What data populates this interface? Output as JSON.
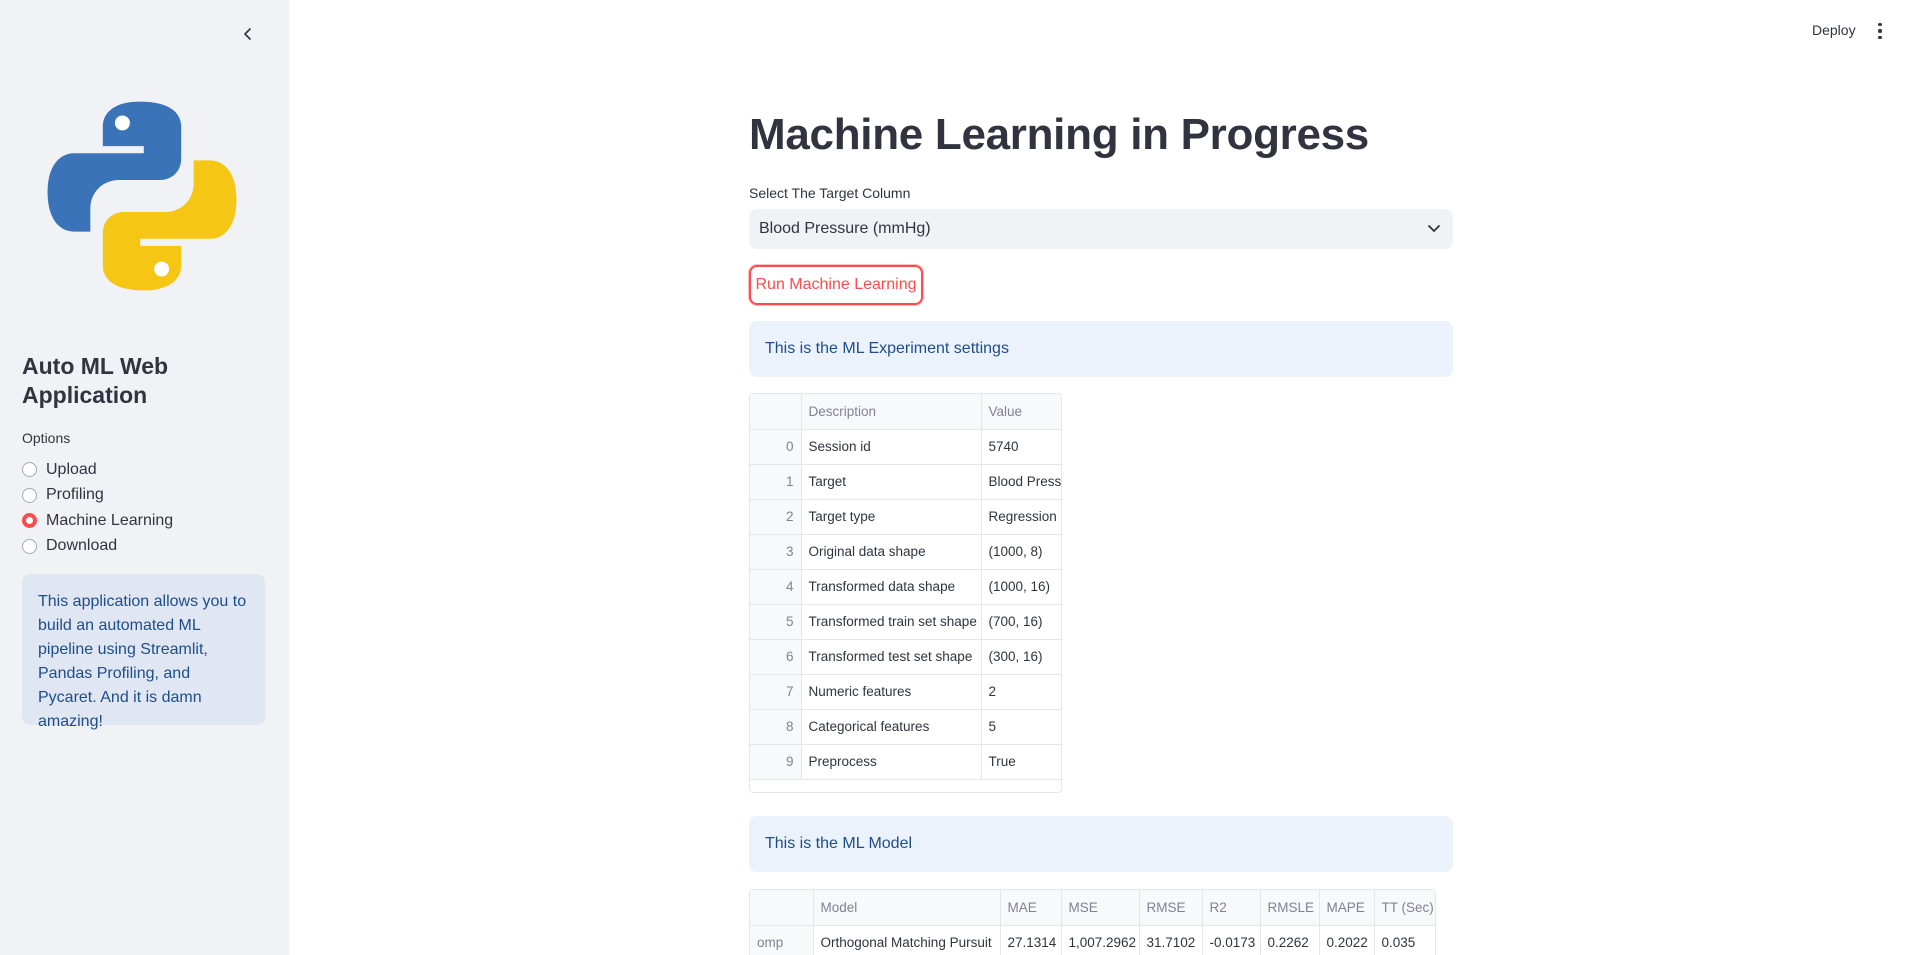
{
  "header": {
    "deploy_label": "Deploy"
  },
  "sidebar": {
    "app_title": "Auto ML Web Application",
    "options_label": "Options",
    "options": [
      {
        "label": "Upload",
        "selected": false
      },
      {
        "label": "Profiling",
        "selected": false
      },
      {
        "label": "Machine Learning",
        "selected": true
      },
      {
        "label": "Download",
        "selected": false
      }
    ],
    "info_text": "This application allows you to build an automated ML pipeline using Streamlit, Pandas Profiling, and Pycaret. And it is damn amazing!"
  },
  "main": {
    "title": "Machine Learning in Progress",
    "select_label": "Select The Target Column",
    "select_value": "Blood Pressure (mmHg)",
    "run_button": "Run Machine Learning",
    "settings_alert": "This is the ML Experiment settings",
    "settings_table": {
      "columns": [
        "",
        "Description",
        "Value"
      ],
      "rows": [
        [
          "0",
          "Session id",
          "5740"
        ],
        [
          "1",
          "Target",
          "Blood Pressure (mmHg)"
        ],
        [
          "2",
          "Target type",
          "Regression"
        ],
        [
          "3",
          "Original data shape",
          "(1000, 8)"
        ],
        [
          "4",
          "Transformed data shape",
          "(1000, 16)"
        ],
        [
          "5",
          "Transformed train set shape",
          "(700, 16)"
        ],
        [
          "6",
          "Transformed test set shape",
          "(300, 16)"
        ],
        [
          "7",
          "Numeric features",
          "2"
        ],
        [
          "8",
          "Categorical features",
          "5"
        ],
        [
          "9",
          "Preprocess",
          "True"
        ]
      ]
    },
    "model_alert": "This is the ML Model",
    "model_table": {
      "columns": [
        "",
        "Model",
        "MAE",
        "MSE",
        "RMSE",
        "R2",
        "RMSLE",
        "MAPE",
        "TT (Sec)"
      ],
      "rows": [
        [
          "omp",
          "Orthogonal Matching Pursuit",
          "27.1314",
          "1,007.2962",
          "31.7102",
          "-0.0173",
          "0.2262",
          "0.2022",
          "0.035"
        ]
      ]
    }
  },
  "colors": {
    "accent": "#FF4B4B",
    "sidebar_bg": "#F0F2F6",
    "info_bg": "#EBF2FC",
    "info_text": "#1D4E89"
  }
}
